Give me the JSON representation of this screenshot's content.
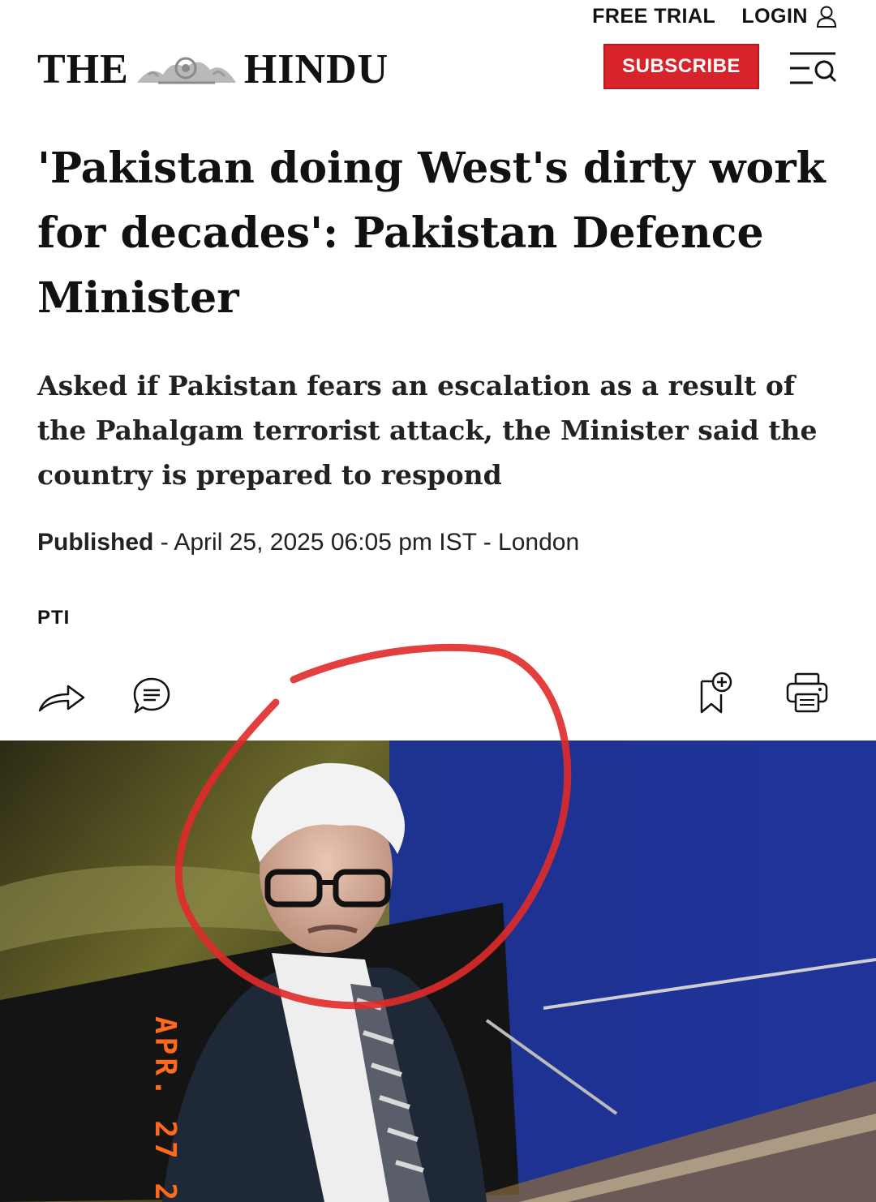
{
  "topbar": {
    "free_trial": "FREE TRIAL",
    "login": "LOGIN"
  },
  "masthead": {
    "logo_left": "THE",
    "logo_right": "HINDU",
    "subscribe": "SUBSCRIBE"
  },
  "article": {
    "headline": "'Pakistan doing West's dirty work for decades': Pakistan Defence Minister",
    "standfirst": "Asked if Pakistan fears an escalation as a result of the Pahalgam terrorist attack, the Minister said the country is prepared to respond",
    "published_label": "Published",
    "published_rest": " - April 25, 2025 06:05 pm IST - London",
    "byline": "PTI"
  },
  "photo": {
    "date_stamp": "APR. 27 2"
  },
  "colors": {
    "subscribe_red": "#d8232a",
    "annotation_red": "#e02a2a",
    "stamp_orange": "#ff6a1a"
  },
  "icons": [
    "user-icon",
    "search-menu-icon",
    "share-icon",
    "comment-icon",
    "bookmark-add-icon",
    "print-icon"
  ]
}
